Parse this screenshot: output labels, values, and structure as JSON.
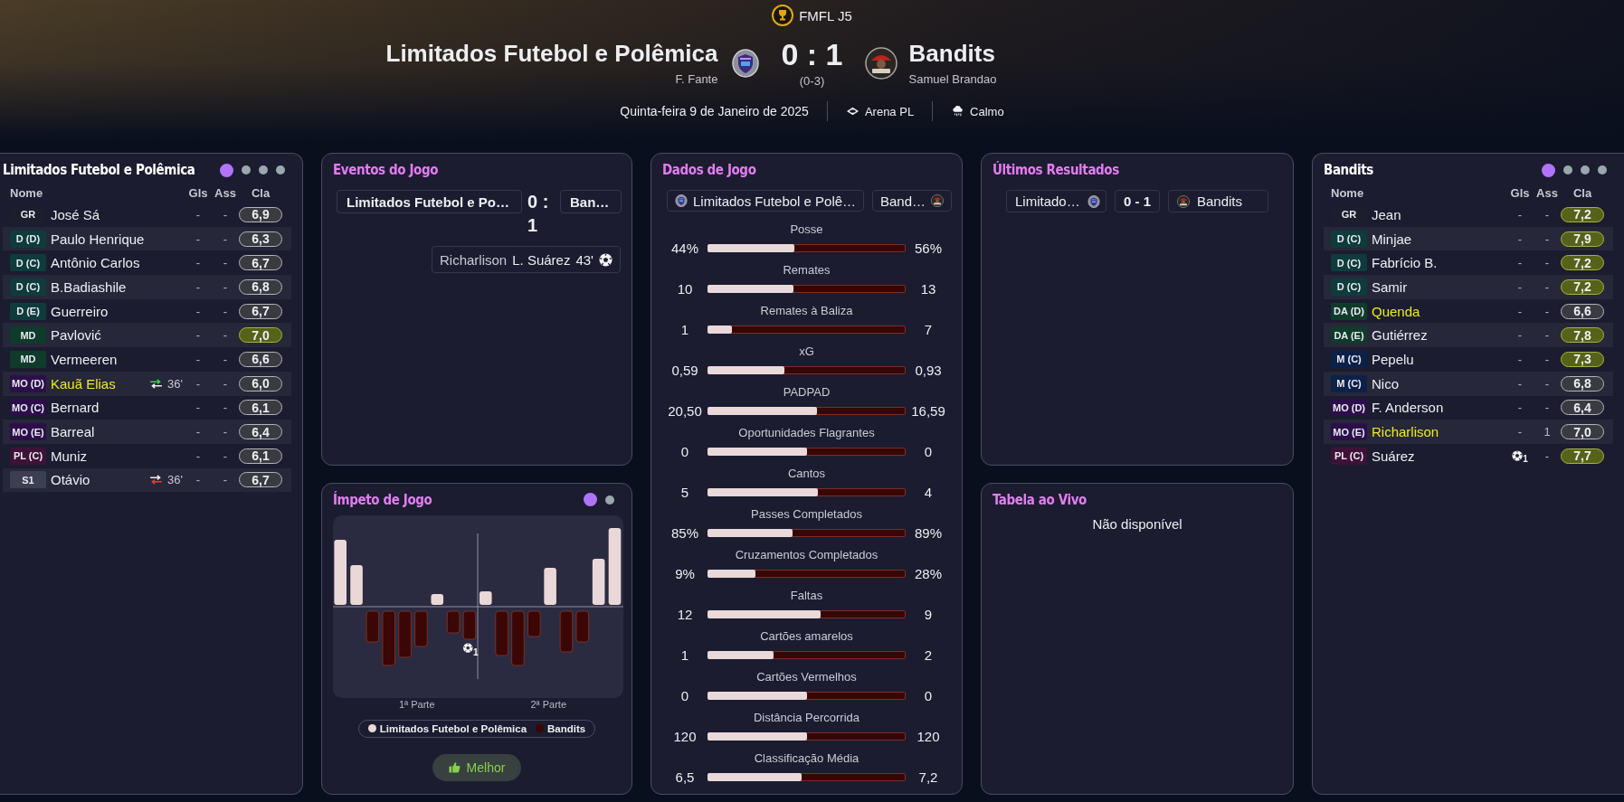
{
  "header": {
    "competition": "FMFL J5",
    "home": {
      "name": "Limitados Futebol e Polêmica",
      "coach": "F. Fante"
    },
    "score": "0 : 1",
    "score_note": "(0-3)",
    "away": {
      "name": "Bandits",
      "coach": "Samuel Brandao"
    },
    "date": "Quinta-feira 9 de Janeiro de 2025",
    "venue": "Arena PL",
    "weather": "Calmo"
  },
  "home_lineup": {
    "title": "Limitados Futebol e Polêmica",
    "pages": [
      {
        "selected": true
      },
      {
        "selected": false
      },
      {
        "selected": false
      },
      {
        "selected": false
      }
    ],
    "columns": [
      "Nome",
      "Gls",
      "Ass",
      "Cla"
    ],
    "rows": [
      {
        "position": {
          "label": "GR",
          "color": "#1c1d2d"
        },
        "name": "José Sá",
        "highlighted": false,
        "goals": {
          "kind": "text",
          "text": "-"
        },
        "assists": "-",
        "rating": "6,9",
        "rating_highlighted": false
      },
      {
        "position": {
          "label": "D (D)",
          "color": "#0e3c3c"
        },
        "name": "Paulo Henrique",
        "highlighted": false,
        "goals": {
          "kind": "text",
          "text": "-"
        },
        "assists": "-",
        "rating": "6,3",
        "rating_highlighted": false
      },
      {
        "position": {
          "label": "D (C)",
          "color": "#0e3c3c"
        },
        "name": "Antônio Carlos",
        "highlighted": false,
        "goals": {
          "kind": "text",
          "text": "-"
        },
        "assists": "-",
        "rating": "6,7",
        "rating_highlighted": false
      },
      {
        "position": {
          "label": "D (C)",
          "color": "#0e3c3c"
        },
        "name": "B.Badiashile",
        "highlighted": false,
        "goals": {
          "kind": "text",
          "text": "-"
        },
        "assists": "-",
        "rating": "6,8",
        "rating_highlighted": false
      },
      {
        "position": {
          "label": "D (E)",
          "color": "#0e3c3c"
        },
        "name": "Guerreiro",
        "highlighted": false,
        "goals": {
          "kind": "text",
          "text": "-"
        },
        "assists": "-",
        "rating": "6,7",
        "rating_highlighted": false
      },
      {
        "position": {
          "label": "MD",
          "color": "#0f3b2b"
        },
        "name": "Pavlović",
        "highlighted": false,
        "goals": {
          "kind": "text",
          "text": "-"
        },
        "assists": "-",
        "rating": "7,0",
        "rating_highlighted": true
      },
      {
        "position": {
          "label": "MD",
          "color": "#0f3b2b"
        },
        "name": "Vermeeren",
        "highlighted": false,
        "goals": {
          "kind": "text",
          "text": "-"
        },
        "assists": "-",
        "rating": "6,6",
        "rating_highlighted": false
      },
      {
        "position": {
          "label": "MO (D)",
          "color": "#2c0f4a"
        },
        "name": "Kauã Elias",
        "highlighted": true,
        "substitution": {
          "kind": "in",
          "minute": "36'"
        },
        "goals": {
          "kind": "text",
          "text": "-"
        },
        "assists": "-",
        "rating": "6,0",
        "rating_highlighted": false
      },
      {
        "position": {
          "label": "MO (C)",
          "color": "#2c0f4a"
        },
        "name": "Bernard",
        "highlighted": false,
        "goals": {
          "kind": "text",
          "text": "-"
        },
        "assists": "-",
        "rating": "6,1",
        "rating_highlighted": false
      },
      {
        "position": {
          "label": "MO (E)",
          "color": "#2c0f4a"
        },
        "name": "Barreal",
        "highlighted": false,
        "goals": {
          "kind": "text",
          "text": "-"
        },
        "assists": "-",
        "rating": "6,4",
        "rating_highlighted": false
      },
      {
        "position": {
          "label": "PL (C)",
          "color": "#3e1238"
        },
        "name": "Muniz",
        "highlighted": false,
        "goals": {
          "kind": "text",
          "text": "-"
        },
        "assists": "-",
        "rating": "6,1",
        "rating_highlighted": false
      },
      {
        "position": {
          "label": "S1",
          "color": "#3c3e52"
        },
        "name": "Otávio",
        "highlighted": false,
        "substitution": {
          "kind": "out",
          "minute": "36'"
        },
        "goals": {
          "kind": "text",
          "text": "-"
        },
        "assists": "-",
        "rating": "6,7",
        "rating_highlighted": false
      }
    ]
  },
  "events": {
    "title": "Eventos do Jogo",
    "home": "Limitados Futebol e Po…",
    "score": "0 : 1",
    "away": "Ban…",
    "items": [
      {
        "kind": "goal",
        "assist": "Richarlison",
        "scorer": "L. Suárez",
        "minute": "43'"
      }
    ]
  },
  "momentum": {
    "title": "Ímpeto de Jogo",
    "pages": [
      {
        "selected": true
      },
      {
        "selected": false
      }
    ],
    "goal_markers": [
      {
        "count": "1"
      }
    ],
    "halves": [
      "1ª Parte",
      "2ª Parte"
    ],
    "legend": [
      {
        "label": "Limitados Futebol e Polêmica",
        "color": "#ead8d8"
      },
      {
        "label": "Bandits",
        "color": "#3a0606"
      }
    ],
    "button": "Melhor"
  },
  "stats": {
    "title": "Dados de Jogo",
    "home": "Limitados Futebol e Polê…",
    "away": "Band…",
    "rows": [
      {
        "label": "Posse",
        "home": "44%",
        "away": "56%",
        "level": 0.44
      },
      {
        "label": "Remates",
        "home": "10",
        "away": "13",
        "level": 0.435
      },
      {
        "label": "Remates à Baliza",
        "home": "1",
        "away": "7",
        "level": 0.125
      },
      {
        "label": "xG",
        "home": "0,59",
        "away": "0,93",
        "level": 0.388
      },
      {
        "label": "PADPAD",
        "home": "20,50",
        "away": "16,59",
        "level": 0.553
      },
      {
        "label": "Oportunidades Flagrantes",
        "home": "0",
        "away": "0",
        "level": 0.5
      },
      {
        "label": "Cantos",
        "home": "5",
        "away": "4",
        "level": 0.556
      },
      {
        "label": "Passes Completados",
        "home": "85%",
        "away": "89%",
        "level": 0.43
      },
      {
        "label": "Cruzamentos Completados",
        "home": "9%",
        "away": "28%",
        "level": 0.243
      },
      {
        "label": "Faltas",
        "home": "12",
        "away": "9",
        "level": 0.571
      },
      {
        "label": "Cartões amarelos",
        "home": "1",
        "away": "2",
        "level": 0.333
      },
      {
        "label": "Cartões Vermelhos",
        "home": "0",
        "away": "0",
        "level": 0.5
      },
      {
        "label": "Distância Percorrida",
        "home": "120",
        "away": "120",
        "level": 0.5
      },
      {
        "label": "Classificação Média",
        "home": "6,5",
        "away": "7,2",
        "level": 0.474
      }
    ]
  },
  "results": {
    "title": "Últimos Resultados",
    "matches": [
      {
        "home": "Limitado…",
        "score": "0 - 1",
        "away": "Bandits"
      }
    ]
  },
  "live_table": {
    "title": "Tabela ao Vivo",
    "message": "Não disponível"
  },
  "away_lineup": {
    "title": "Bandits",
    "pages": [
      {
        "selected": true
      },
      {
        "selected": false
      },
      {
        "selected": false
      },
      {
        "selected": false
      }
    ],
    "columns": [
      "Nome",
      "Gls",
      "Ass",
      "Cla"
    ],
    "rows": [
      {
        "position": {
          "label": "GR",
          "color": "#1c1d2d"
        },
        "name": "Jean",
        "highlighted": false,
        "goals": {
          "kind": "text",
          "text": "-"
        },
        "assists": "-",
        "rating": "7,2",
        "rating_highlighted": true
      },
      {
        "position": {
          "label": "D (C)",
          "color": "#0e3c3c"
        },
        "name": "Minjae",
        "highlighted": false,
        "goals": {
          "kind": "text",
          "text": "-"
        },
        "assists": "-",
        "rating": "7,9",
        "rating_highlighted": true
      },
      {
        "position": {
          "label": "D (C)",
          "color": "#0e3c3c"
        },
        "name": "Fabrício B.",
        "highlighted": false,
        "goals": {
          "kind": "text",
          "text": "-"
        },
        "assists": "-",
        "rating": "7,2",
        "rating_highlighted": true
      },
      {
        "position": {
          "label": "D (C)",
          "color": "#0e3c3c"
        },
        "name": "Samir",
        "highlighted": false,
        "goals": {
          "kind": "text",
          "text": "-"
        },
        "assists": "-",
        "rating": "7,2",
        "rating_highlighted": true
      },
      {
        "position": {
          "label": "DA (D)",
          "color": "#0f3b2b"
        },
        "name": "Quenda",
        "highlighted": true,
        "goals": {
          "kind": "text",
          "text": "-"
        },
        "assists": "-",
        "rating": "6,6",
        "rating_highlighted": false
      },
      {
        "position": {
          "label": "DA (E)",
          "color": "#0f3b2b"
        },
        "name": "Gutiérrez",
        "highlighted": false,
        "goals": {
          "kind": "text",
          "text": "-"
        },
        "assists": "-",
        "rating": "7,8",
        "rating_highlighted": true
      },
      {
        "position": {
          "label": "M (C)",
          "color": "#0c2148"
        },
        "name": "Pepelu",
        "highlighted": false,
        "goals": {
          "kind": "text",
          "text": "-"
        },
        "assists": "-",
        "rating": "7,3",
        "rating_highlighted": true
      },
      {
        "position": {
          "label": "M (C)",
          "color": "#0c2148"
        },
        "name": "Nico",
        "highlighted": false,
        "goals": {
          "kind": "text",
          "text": "-"
        },
        "assists": "-",
        "rating": "6,8",
        "rating_highlighted": false
      },
      {
        "position": {
          "label": "MO (D)",
          "color": "#2c0f4a"
        },
        "name": "F. Anderson",
        "highlighted": false,
        "goals": {
          "kind": "text",
          "text": "-"
        },
        "assists": "-",
        "rating": "6,4",
        "rating_highlighted": false
      },
      {
        "position": {
          "label": "MO (E)",
          "color": "#2c0f4a"
        },
        "name": "Richarlison",
        "highlighted": true,
        "goals": {
          "kind": "text",
          "text": "-"
        },
        "assists": "1",
        "rating": "7,0",
        "rating_highlighted": false
      },
      {
        "position": {
          "label": "PL (C)",
          "color": "#3e1238"
        },
        "name": "Suárez",
        "highlighted": false,
        "goals": {
          "kind": "ball",
          "text": "1"
        },
        "assists": "-",
        "rating": "7,7",
        "rating_highlighted": true
      }
    ]
  }
}
